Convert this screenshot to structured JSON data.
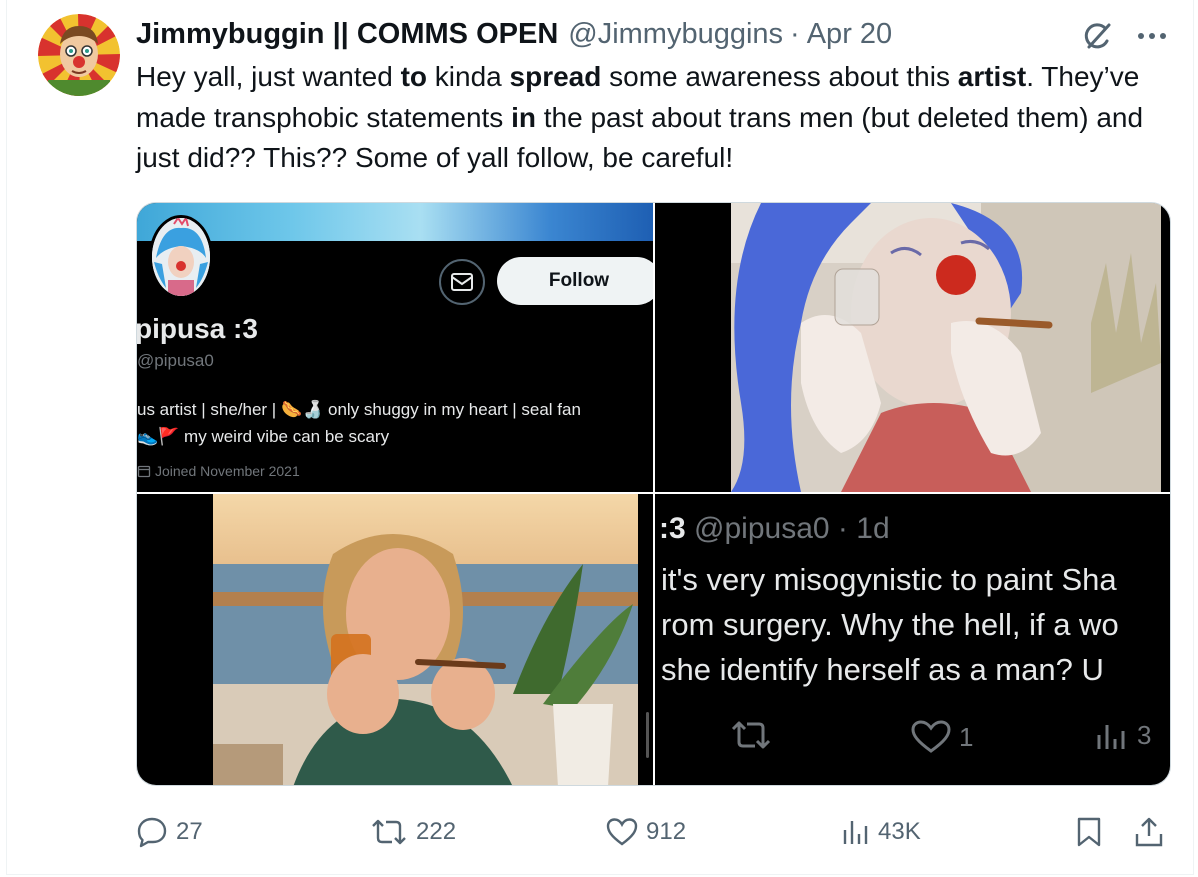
{
  "tweet": {
    "display_name": "Jimmybuggin || COMMS OPEN",
    "handle": "@Jimmybuggins",
    "separator": "·",
    "date": "Apr 20",
    "text_parts": [
      {
        "t": "Hey yall, just wanted ",
        "b": false
      },
      {
        "t": "to",
        "b": true
      },
      {
        "t": " kinda ",
        "b": false
      },
      {
        "t": "spread",
        "b": true
      },
      {
        "t": " some awareness about this ",
        "b": false
      },
      {
        "t": "artist",
        "b": true
      },
      {
        "t": ". They’ve made transphobic statements ",
        "b": false
      },
      {
        "t": "in",
        "b": true
      },
      {
        "t": " the past about trans men (but deleted them) and just did?? This?? Some of yall follow, be careful!",
        "b": false
      }
    ],
    "actions": {
      "replies": "27",
      "reposts": "222",
      "likes": "912",
      "views": "43K"
    }
  },
  "media": {
    "profile_card": {
      "follow_label": "Follow",
      "name": "pipusa :3",
      "handle": "@pipusa0",
      "bio_line1": "us artist | she/her | 🌭🍶 only shuggy in my heart | seal fan",
      "bio_line2": "👟🚩 my weird vibe can be scary",
      "joined": "Joined November 2021"
    },
    "quoted_post": {
      "name": ":3",
      "handle": "@pipusa0",
      "separator": "·",
      "time": "1d",
      "line1": "it's very misogynistic to paint Sha",
      "line2": "rom surgery. Why the hell, if a wo",
      "line3": "she identify herself as a man? U",
      "likes": "1",
      "views": "3"
    }
  },
  "colors": {
    "text_primary": "#0f1419",
    "text_secondary": "#536471",
    "dark_bg": "#000000",
    "dark_text": "#e7e9ea",
    "dark_secondary": "#71767b"
  }
}
